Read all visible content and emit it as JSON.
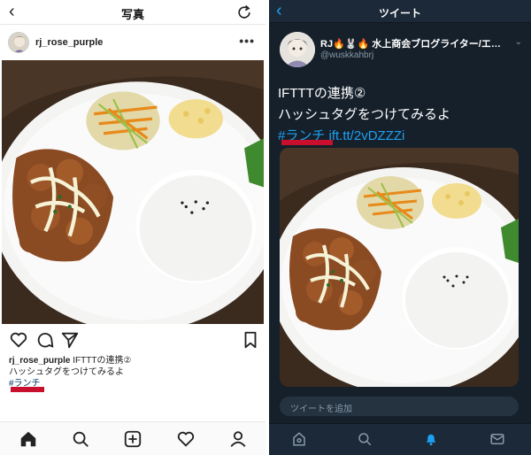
{
  "instagram": {
    "header": {
      "back_icon": "chevron-left-icon",
      "title": "写真",
      "refresh_icon": "refresh-icon"
    },
    "post": {
      "username": "rj_rose_purple",
      "more_icon": "more-horizontal-icon",
      "more_label": "•••",
      "caption": {
        "user": "rj_rose_purple",
        "line1": "IFTTTの連携②",
        "line2": "ハッシュタグをつけてみるよ",
        "hashtag": "#ランチ"
      },
      "actions": [
        "heart-icon",
        "comment-icon",
        "share-icon",
        "bookmark-icon"
      ]
    },
    "tabbar": [
      "home-icon",
      "search-icon",
      "add-post-icon",
      "activity-icon",
      "profile-icon"
    ]
  },
  "twitter": {
    "header": {
      "back_icon": "chevron-left-icon",
      "title": "ツイート"
    },
    "tweet": {
      "name": "RJ🔥🐰🔥 水上商会ブログライター/エ…",
      "handle": "@wuskkahbrj",
      "line1": "IFTTTの連携②",
      "line2": "ハッシュタグをつけてみるよ",
      "hashtag": "#ランチ",
      "link": "ift.tt/2vDZZZi"
    },
    "reply_placeholder": "ツイートを追加",
    "tabbar": [
      "home-icon",
      "search-icon",
      "notifications-icon",
      "messages-icon"
    ]
  },
  "colors": {
    "twitter_bg": "#15202b",
    "twitter_accent": "#1da1f2",
    "highlight_underline": "#c8102e",
    "instagram_hashtag": "#003569"
  }
}
